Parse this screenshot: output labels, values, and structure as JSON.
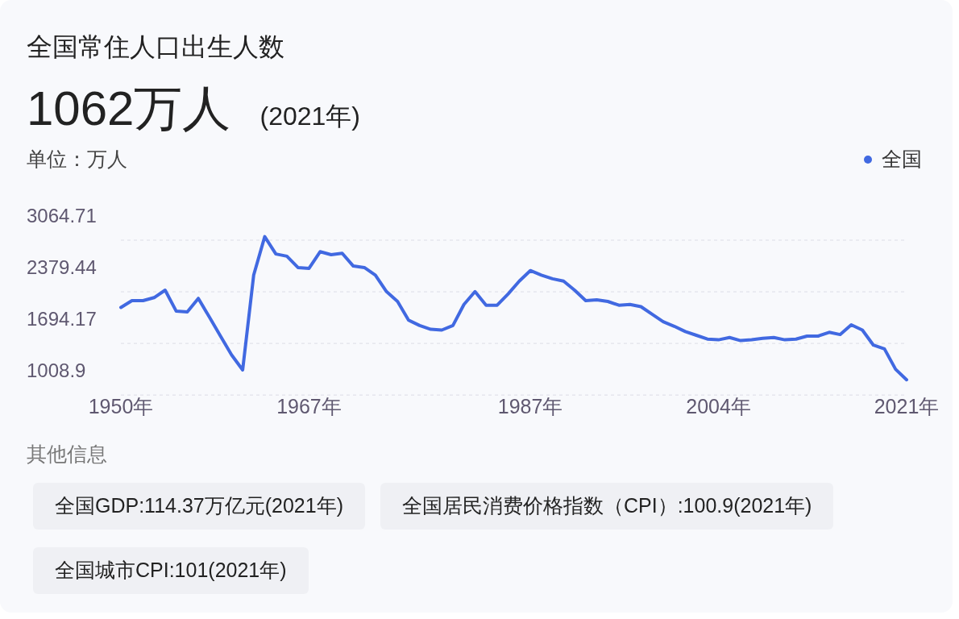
{
  "title": "全国常住人口出生人数",
  "headline": {
    "value": "1062万人",
    "year": "(2021年)"
  },
  "unit_label": "单位：万人",
  "chart_data": {
    "type": "line",
    "x": [
      1950,
      1951,
      1952,
      1953,
      1954,
      1955,
      1956,
      1957,
      1958,
      1959,
      1960,
      1961,
      1962,
      1963,
      1964,
      1965,
      1966,
      1967,
      1968,
      1969,
      1970,
      1971,
      1972,
      1973,
      1974,
      1975,
      1976,
      1977,
      1978,
      1979,
      1980,
      1981,
      1982,
      1983,
      1984,
      1985,
      1986,
      1987,
      1988,
      1989,
      1990,
      1991,
      1992,
      1993,
      1994,
      1995,
      1996,
      1997,
      1998,
      1999,
      2000,
      2001,
      2002,
      2003,
      2004,
      2005,
      2006,
      2007,
      2008,
      2009,
      2010,
      2011,
      2012,
      2013,
      2014,
      2015,
      2016,
      2017,
      2018,
      2019,
      2020,
      2021
    ],
    "series": [
      {
        "name": "全国",
        "color": "#4169e1",
        "values": [
          1840,
          1930,
          1930,
          1970,
          2070,
          1790,
          1780,
          1960,
          1710,
          1460,
          1210,
          1010,
          2270,
          2780,
          2550,
          2520,
          2370,
          2360,
          2580,
          2540,
          2560,
          2390,
          2370,
          2270,
          2050,
          1920,
          1670,
          1600,
          1550,
          1540,
          1600,
          1880,
          2050,
          1870,
          1870,
          2020,
          2190,
          2330,
          2270,
          2220,
          2190,
          2070,
          1930,
          1940,
          1920,
          1870,
          1880,
          1850,
          1750,
          1650,
          1590,
          1520,
          1470,
          1420,
          1410,
          1440,
          1400,
          1410,
          1430,
          1440,
          1410,
          1420,
          1460,
          1460,
          1510,
          1480,
          1610,
          1540,
          1340,
          1290,
          1020,
          880
        ]
      }
    ],
    "xlim": [
      1950,
      2021
    ],
    "ylim": [
      700,
      3064.71
    ],
    "xticks": [
      {
        "value": 1950,
        "label": "1950年"
      },
      {
        "value": 1967,
        "label": "1967年"
      },
      {
        "value": 1987,
        "label": "1987年"
      },
      {
        "value": 2004,
        "label": "2004年"
      },
      {
        "value": 2021,
        "label": "2021年"
      }
    ],
    "yticks": [
      {
        "value": 1008.9,
        "label": "1008.9"
      },
      {
        "value": 1694.17,
        "label": "1694.17"
      },
      {
        "value": 2379.44,
        "label": "2379.44"
      },
      {
        "value": 3064.71,
        "label": "3064.71"
      }
    ]
  },
  "other_info": {
    "heading": "其他信息",
    "tags": [
      "全国GDP:114.37万亿元(2021年)",
      "全国居民消费价格指数（CPI）:100.9(2021年)",
      "全国城市CPI:101(2021年)"
    ]
  }
}
